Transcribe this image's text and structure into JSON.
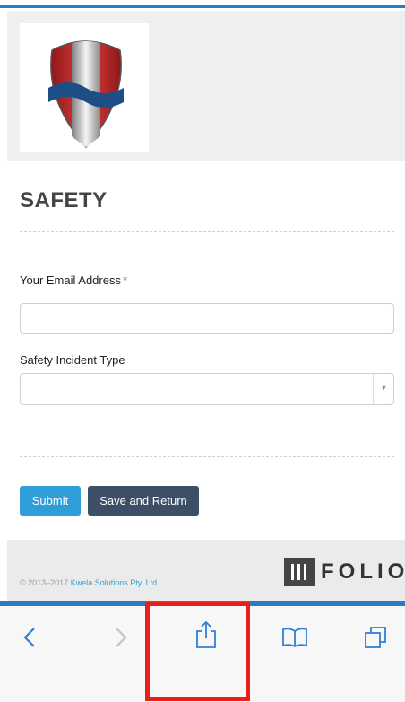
{
  "colors": {
    "accent": "#2f9ed8",
    "dark_button": "#3d4f66",
    "top_bar": "#2a7bc0",
    "highlight": "#e8201c"
  },
  "logo": {
    "icon": "shield-logo"
  },
  "page": {
    "title": "SAFETY"
  },
  "form": {
    "email_label": "Your Email Address",
    "required_marker": "*",
    "email_value": "",
    "incident_label": "Safety Incident Type",
    "incident_selected": ""
  },
  "buttons": {
    "submit": "Submit",
    "save_return": "Save and Return"
  },
  "footer": {
    "copyright": "© 2013–2017",
    "company": "Kwela Solutions Pty. Ltd.",
    "brand": "FOLIO"
  },
  "browser_toolbar": {
    "icons": [
      "back-icon",
      "forward-icon",
      "share-icon",
      "bookmarks-icon",
      "tabs-icon"
    ]
  }
}
